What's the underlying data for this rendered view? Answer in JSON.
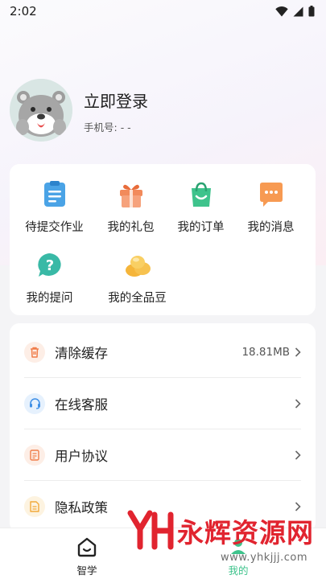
{
  "status_bar": {
    "time": "2:02"
  },
  "profile": {
    "login_title": "立即登录",
    "phone_label": "手机号:",
    "phone_value": "- -"
  },
  "quick_grid": [
    {
      "label": "待提交作业",
      "icon": "homework-doc-icon",
      "color": "#4aa3e6"
    },
    {
      "label": "我的礼包",
      "icon": "gift-icon",
      "color": "#f28a5b"
    },
    {
      "label": "我的订单",
      "icon": "shopping-bag-icon",
      "color": "#3ec38c"
    },
    {
      "label": "我的消息",
      "icon": "message-bubble-icon",
      "color": "#f79a52"
    },
    {
      "label": "我的提问",
      "icon": "question-bubble-icon",
      "color": "#39b9a6"
    },
    {
      "label": "我的全品豆",
      "icon": "coin-beans-icon",
      "color": "#f5b53a"
    }
  ],
  "menu": [
    {
      "label": "清除缓存",
      "value": "18.81MB",
      "icon": "trash-icon",
      "color": "#f07d4a"
    },
    {
      "label": "在线客服",
      "value": "",
      "icon": "headset-icon",
      "color": "#3e8fe6"
    },
    {
      "label": "用户协议",
      "value": "",
      "icon": "agreement-doc-icon",
      "color": "#f07d4a"
    },
    {
      "label": "隐私政策",
      "value": "",
      "icon": "privacy-doc-icon",
      "color": "#f2a93a"
    }
  ],
  "tabbar": {
    "tabs": [
      {
        "label": "智学",
        "icon": "home-smile-icon"
      },
      {
        "label": "我的",
        "icon": "profile-icon"
      }
    ]
  },
  "watermark": {
    "text": "永辉资源网",
    "url": "www.yhkjjj.com"
  }
}
